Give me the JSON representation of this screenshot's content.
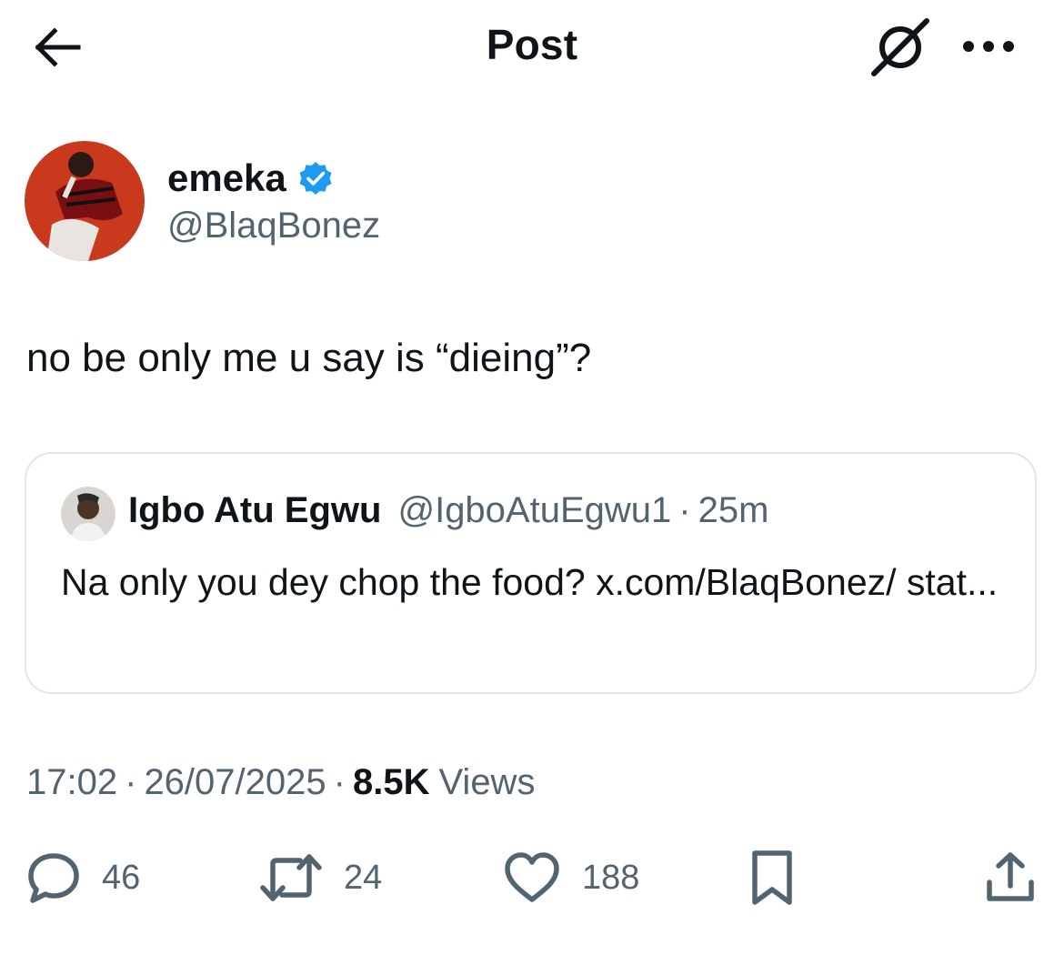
{
  "header": {
    "title": "Post",
    "back_icon": "arrow-left-icon",
    "grok_icon": "grok-icon",
    "more_icon": "more-horizontal-icon"
  },
  "post": {
    "author": {
      "name": "emeka",
      "handle": "@BlaqBonez",
      "verified": true,
      "verified_color": "#1d9bf0"
    },
    "text": "no be only me u say is “dieing”?",
    "quote": {
      "name": "Igbo Atu Egwu",
      "handle": "@IgboAtuEgwu1",
      "separator": "·",
      "time": "25m",
      "text": "Na only you dey chop the food? x.com/BlaqBonez/ stat..."
    },
    "meta": {
      "time": "17:02",
      "separator": "·",
      "date": "26/07/2025",
      "views_count": "8.5K",
      "views_label": "Views"
    },
    "actions": {
      "replies": "46",
      "reposts": "24",
      "likes": "188"
    }
  },
  "colors": {
    "text_primary": "#0f1419",
    "text_secondary": "#536471",
    "border": "#e1e6ea"
  }
}
